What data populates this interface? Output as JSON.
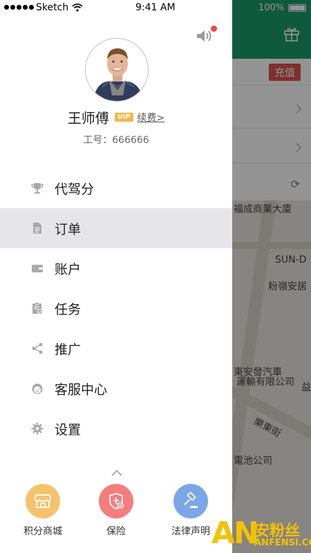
{
  "status_bar": {
    "carrier": "Sketch",
    "time": "9:41 AM",
    "battery": "100%"
  },
  "background": {
    "recharge_label": "充值",
    "map_labels": [
      "福成商業大廈",
      "SUN-D",
      "粉嶺安居",
      "東安發汽車",
      "運輸有限公司",
      "樂東街",
      "電池公司",
      "益"
    ]
  },
  "profile": {
    "name": "王师傅",
    "vip_badge": "VIP",
    "renew_link": "续费>",
    "employee_id": "工号：666666"
  },
  "menu": {
    "items": [
      {
        "label": "代驾分",
        "icon": "trophy-icon"
      },
      {
        "label": "订单",
        "icon": "document-icon"
      },
      {
        "label": "账户",
        "icon": "wallet-icon"
      },
      {
        "label": "任务",
        "icon": "clipboard-check-icon"
      },
      {
        "label": "推广",
        "icon": "share-icon"
      },
      {
        "label": "客服中心",
        "icon": "customer-service-icon"
      },
      {
        "label": "设置",
        "icon": "gear-icon"
      }
    ],
    "active_index": 1
  },
  "shortcuts": [
    {
      "label": "积分商城",
      "icon": "store-icon",
      "color": "#f5c36b"
    },
    {
      "label": "保险",
      "icon": "shield-icon",
      "color": "#f47d7d"
    },
    {
      "label": "法律声明",
      "icon": "gavel-icon",
      "color": "#7ba7e8"
    }
  ],
  "watermark": {
    "logo": "AN",
    "cn": "安粉丝",
    "en": "ANFENSI.COM"
  },
  "colors": {
    "header_green": "#1a9a6d",
    "active_row": "#e6e6ea",
    "vip": "#f0b84a",
    "notification_dot": "#f04848",
    "recharge": "#d9534f"
  }
}
